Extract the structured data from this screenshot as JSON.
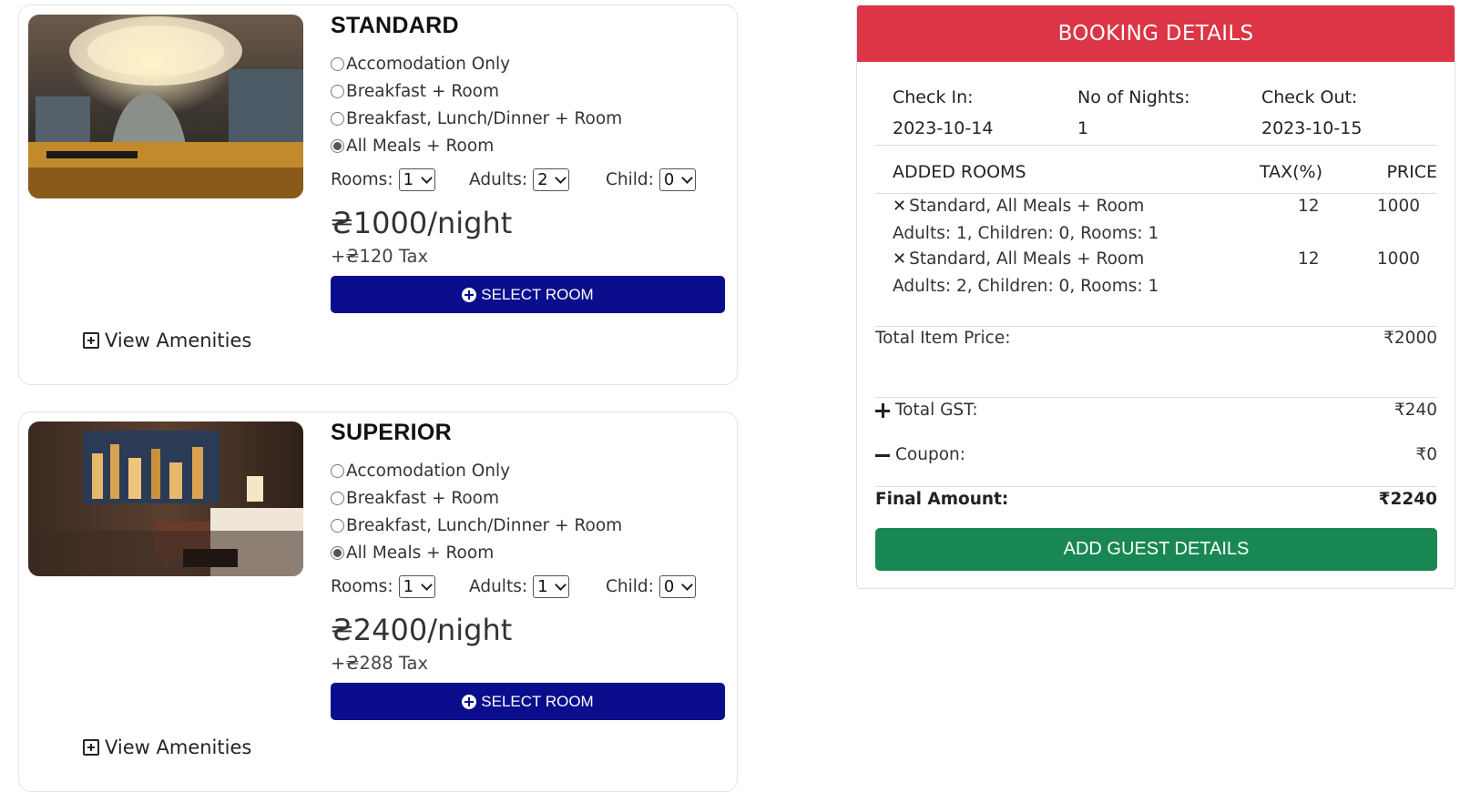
{
  "rooms": [
    {
      "title": "STANDARD",
      "plans": [
        "Accomodation Only",
        "Breakfast + Room",
        "Breakfast, Lunch/Dinner + Room",
        "All Meals + Room"
      ],
      "selected_plan": "All Meals + Room",
      "rooms_label": "Rooms:",
      "rooms_value": "1",
      "adults_label": "Adults:",
      "adults_value": "2",
      "child_label": "Child:",
      "child_value": "0",
      "price": "₴1000/night",
      "tax": "+₴120 Tax",
      "select_label": "SELECT ROOM",
      "amenities_label": "View Amenities"
    },
    {
      "title": "SUPERIOR",
      "plans": [
        "Accomodation Only",
        "Breakfast + Room",
        "Breakfast, Lunch/Dinner + Room",
        "All Meals + Room"
      ],
      "selected_plan": "All Meals + Room",
      "rooms_label": "Rooms:",
      "rooms_value": "1",
      "adults_label": "Adults:",
      "adults_value": "1",
      "child_label": "Child:",
      "child_value": "0",
      "price": "₴2400/night",
      "tax": "+₴288 Tax",
      "select_label": "SELECT ROOM",
      "amenities_label": "View Amenities"
    }
  ],
  "booking": {
    "header": "BOOKING DETAILS",
    "check_in_label": "Check In:",
    "check_in": "2023-10-14",
    "nights_label": "No of Nights:",
    "nights": "1",
    "check_out_label": "Check Out:",
    "check_out": "2023-10-15",
    "added_rooms_label": "ADDED ROOMS",
    "tax_label": "TAX(%)",
    "price_label": "PRICE",
    "entries": [
      {
        "name": "Standard, All Meals + Room",
        "details": "Adults: 1, Children: 0, Rooms: 1",
        "tax": "12",
        "price": "1000"
      },
      {
        "name": "Standard, All Meals + Room",
        "details": "Adults: 2, Children: 0, Rooms: 1",
        "tax": "12",
        "price": "1000"
      }
    ],
    "total_item_label": "Total Item Price:",
    "total_item": "₹2000",
    "gst_label": "Total GST:",
    "gst": "₹240",
    "coupon_label": "Coupon:",
    "coupon": "₹0",
    "final_label": "Final Amount:",
    "final": "₹2240",
    "guest_button": "ADD GUEST DETAILS"
  },
  "colors": {
    "header_red": "#dc3545",
    "select_blue": "#0a0d8c",
    "guest_green": "#198754"
  }
}
